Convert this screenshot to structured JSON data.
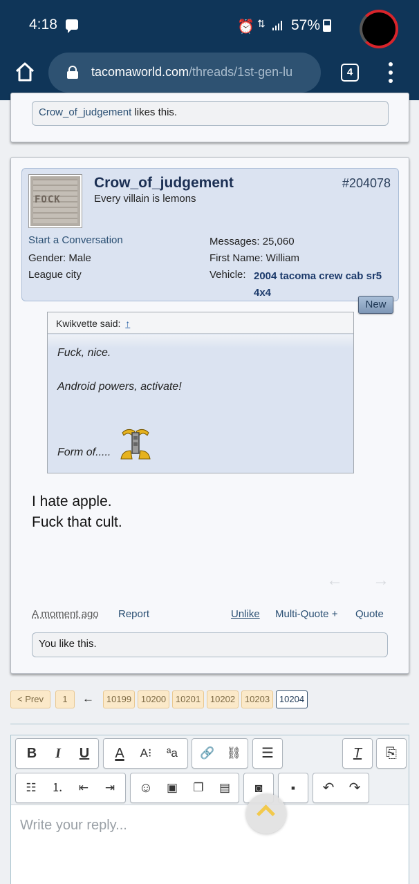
{
  "status_bar": {
    "time": "4:18",
    "battery": "57%",
    "data_indicator": "⇅"
  },
  "browser": {
    "url_domain": "tacomaworld.com",
    "url_path": "/threads/1st-gen-lu",
    "tab_count": "4"
  },
  "prev_post": {
    "likes_user": "Crow_of_judgement",
    "likes_suffix": " likes this."
  },
  "post": {
    "avatar_text": "FOCK",
    "username": "Crow_of_judgement",
    "user_title": "Every villain is lemons",
    "post_number": "#204078",
    "start_conversation": "Start a Conversation",
    "gender": "Gender:  Male",
    "location": "League city",
    "messages": "Messages:  25,060",
    "first_name": "First Name:  William",
    "vehicle_label": "Vehicle:",
    "vehicle_value": "2004 tacoma crew cab sr5 4x4",
    "new_badge": "New",
    "quote": {
      "author": "Kwikvette said:",
      "arrow": "↑",
      "lines": [
        "Fuck, nice.",
        "Android powers, activate!",
        "Form of....."
      ]
    },
    "message_lines": [
      "I hate apple.",
      "Fuck that cult."
    ],
    "time_ago": "A moment ago",
    "report": "Report",
    "unlike": "Unlike",
    "multi_quote": "Multi-Quote +",
    "quote_btn": "Quote",
    "likes_text": "You like this."
  },
  "pagination": {
    "prev": "< Prev",
    "first": "1",
    "back_arrow": "←",
    "pages": [
      "10199",
      "10200",
      "10201",
      "10202",
      "10203"
    ],
    "current": "10204"
  },
  "editor": {
    "placeholder": "Write your reply...",
    "toolbar_row1": [
      "B",
      "I",
      "U",
      "A",
      "A↕",
      "aa",
      "link",
      "unlink",
      "align",
      "clear-format",
      "toggle-bbcode"
    ],
    "toolbar_row2": [
      "bullet-list",
      "number-list",
      "outdent",
      "indent",
      "smilies",
      "image",
      "media",
      "quote-block",
      "camera",
      "save",
      "undo",
      "redo"
    ]
  }
}
